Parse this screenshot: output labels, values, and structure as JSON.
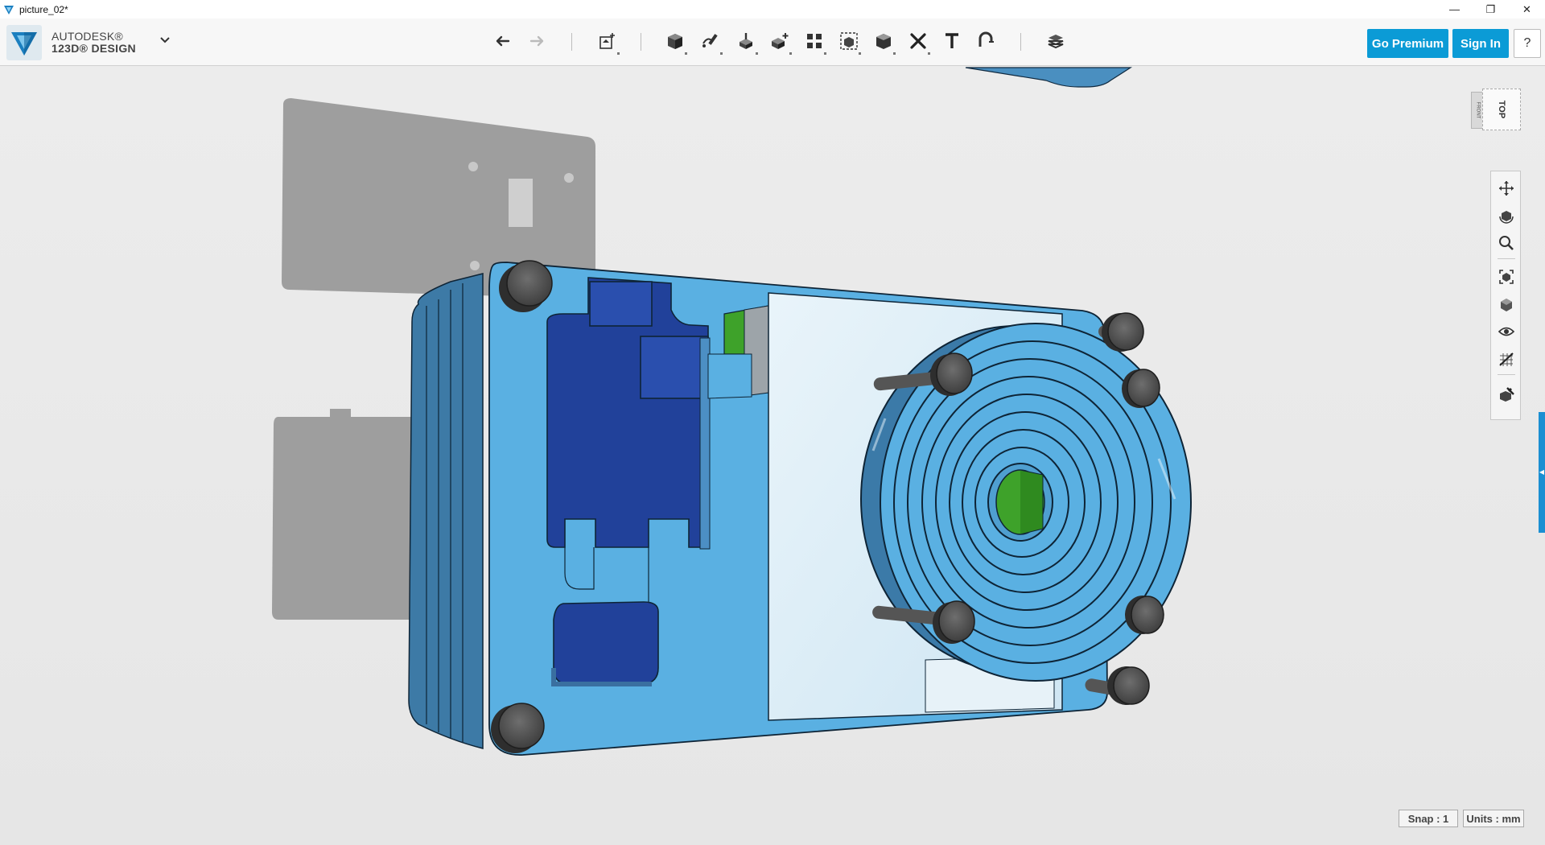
{
  "window": {
    "title": "picture_02*",
    "minimize_glyph": "—",
    "restore_glyph": "❐",
    "close_glyph": "✕"
  },
  "brand": {
    "line1": "AUTODESK®",
    "line2": "123D® DESIGN",
    "logo_icon": "autodesk-123d-logo-icon",
    "menu_icon": "chevron-down-icon"
  },
  "toolbar": {
    "tools": [
      {
        "name": "undo",
        "icon": "undo-icon",
        "has_menu": false
      },
      {
        "name": "redo",
        "icon": "redo-icon",
        "has_menu": false
      },
      {
        "name": "transform",
        "icon": "transform-icon",
        "has_menu": true
      },
      {
        "name": "primitives",
        "icon": "primitives-icon",
        "has_menu": true
      },
      {
        "name": "sketch",
        "icon": "sketch-icon",
        "has_menu": true
      },
      {
        "name": "construct",
        "icon": "construct-icon",
        "has_menu": true
      },
      {
        "name": "modify",
        "icon": "modify-icon",
        "has_menu": true
      },
      {
        "name": "pattern",
        "icon": "pattern-icon",
        "has_menu": true
      },
      {
        "name": "grouping",
        "icon": "grouping-icon",
        "has_menu": true
      },
      {
        "name": "combine",
        "icon": "combine-icon",
        "has_menu": true
      },
      {
        "name": "measure",
        "icon": "measure-icon",
        "has_menu": true
      },
      {
        "name": "text",
        "icon": "text-icon",
        "has_menu": false
      },
      {
        "name": "snap",
        "icon": "snap-icon",
        "has_menu": false
      },
      {
        "name": "materials",
        "icon": "materials-icon",
        "has_menu": false
      }
    ],
    "premium_label": "Go Premium",
    "signin_label": "Sign In",
    "help_label": "?"
  },
  "viewcube": {
    "top_label": "TOP",
    "side_label": "FRONT"
  },
  "navbar": {
    "tools": [
      "pan-icon",
      "orbit-icon",
      "zoom-icon",
      "fit-icon",
      "views-icon",
      "visibility-icon",
      "grid-icon",
      "material-toggle-icon"
    ]
  },
  "status": {
    "snap": "Snap : 1",
    "units": "Units : mm"
  },
  "colors": {
    "accent": "#0b9bd6",
    "body_blue": "#5aafe0",
    "dark_blue": "#21419a",
    "green": "#3ea22a"
  }
}
